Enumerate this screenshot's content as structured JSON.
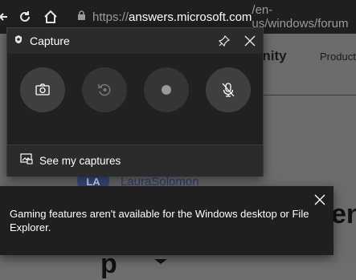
{
  "browser": {
    "url_prefix": "https://",
    "url_host": "answers.microsoft.com",
    "url_path": "/en-us/windows/forum"
  },
  "page": {
    "community_partial": "unity",
    "products_partial": "Product",
    "avatar_initials": "LA",
    "username": "LauraSolomon",
    "big_letter": "en",
    "bottom_glyph": "p"
  },
  "capture_widget": {
    "title": "Capture",
    "see_captures_label": "See my captures",
    "buttons": [
      {
        "icon": "camera-icon"
      },
      {
        "icon": "record-last-icon"
      },
      {
        "icon": "record-icon"
      },
      {
        "icon": "mic-off-icon"
      }
    ]
  },
  "toast": {
    "message": "Gaming features aren't available for the Windows desktop or File Explorer."
  },
  "colors": {
    "panel_bg": "#2b2b2b",
    "panel_body_bg": "#212121",
    "toast_bg": "#1f1f1f",
    "text": "#ffffff",
    "link": "#2e3f73"
  }
}
